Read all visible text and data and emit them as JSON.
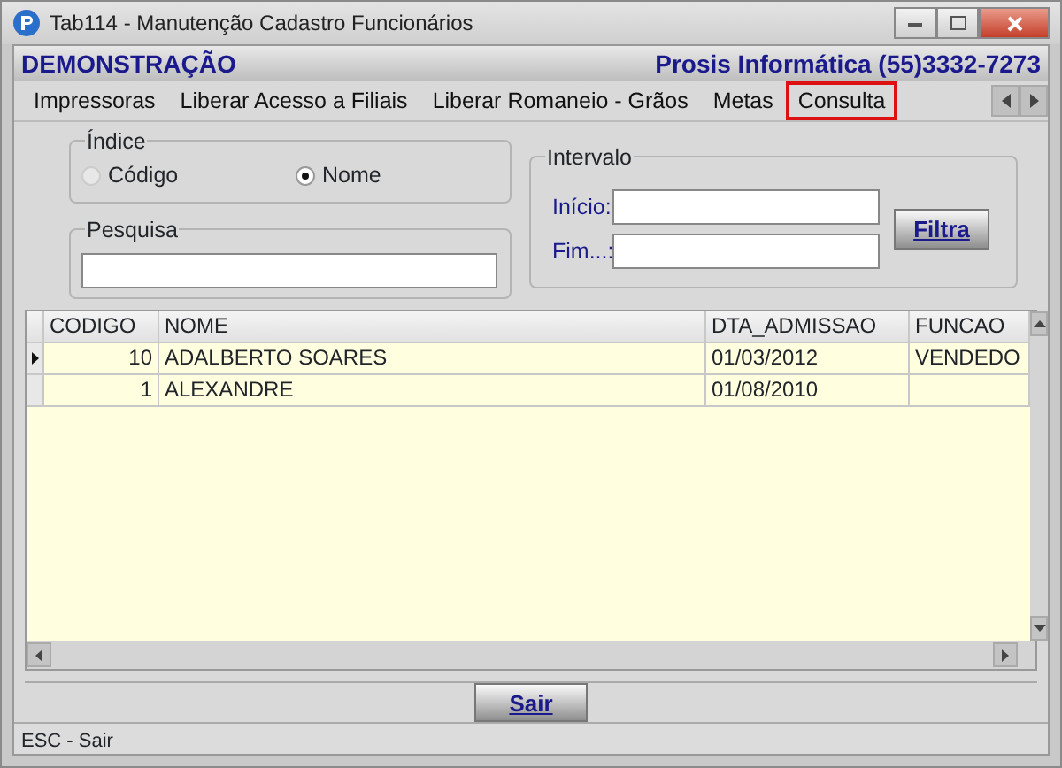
{
  "window": {
    "title": "Tab114 - Manutenção Cadastro Funcionários"
  },
  "header": {
    "company": "DEMONSTRAÇÃO",
    "vendor": "Prosis Informática (55)3332-7273"
  },
  "tabs": [
    {
      "label": "Impressoras",
      "selected": false
    },
    {
      "label": "Liberar Acesso a Filiais",
      "selected": false
    },
    {
      "label": "Liberar Romaneio - Grãos",
      "selected": false
    },
    {
      "label": "Metas",
      "selected": false
    },
    {
      "label": "Consulta",
      "selected": true
    }
  ],
  "indice": {
    "title": "Índice",
    "options": [
      {
        "label": "Código",
        "selected": false
      },
      {
        "label": "Nome",
        "selected": true
      }
    ]
  },
  "pesquisa": {
    "title": "Pesquisa"
  },
  "intervalo": {
    "title": "Intervalo",
    "fields": [
      {
        "label": "Início:"
      },
      {
        "label": "Fim...:"
      }
    ],
    "button": "Filtra"
  },
  "table": {
    "columns": [
      "CODIGO",
      "NOME",
      "DTA_ADMISSAO",
      "FUNCAO"
    ],
    "rows": [
      {
        "current": true,
        "cells": [
          "10",
          "ADALBERTO SOARES",
          "01/03/2012",
          "VENDEDO"
        ]
      },
      {
        "current": false,
        "cells": [
          "1",
          "ALEXANDRE",
          "01/08/2010",
          ""
        ]
      }
    ]
  },
  "buttons": [
    "Sair"
  ],
  "status_bar": "ESC - Sair"
}
